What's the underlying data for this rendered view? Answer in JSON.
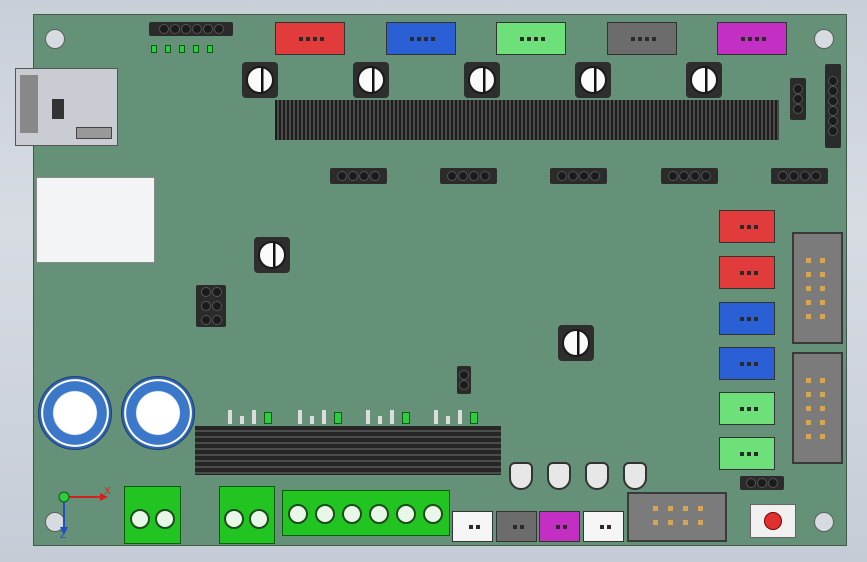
{
  "view": {
    "axis_x_label": "X",
    "axis_z_label": "Z"
  },
  "colors": {
    "board": "#659178",
    "jst_red": "#e23b3b",
    "jst_blue": "#2a5fd6",
    "jst_lightgreen": "#6ee07a",
    "jst_gray": "#6c6c6c",
    "jst_magenta": "#c22fc2",
    "jst_white": "#f5f5f5",
    "terminal_green": "#21c421",
    "reset_button": "#e03030"
  },
  "top_connectors": [
    "red",
    "blue",
    "lightgreen",
    "gray",
    "magenta"
  ],
  "right_connectors": [
    "red",
    "red",
    "blue",
    "blue",
    "lightgreen",
    "lightgreen"
  ],
  "bottom_connectors": [
    "white",
    "gray",
    "magenta",
    "white"
  ]
}
